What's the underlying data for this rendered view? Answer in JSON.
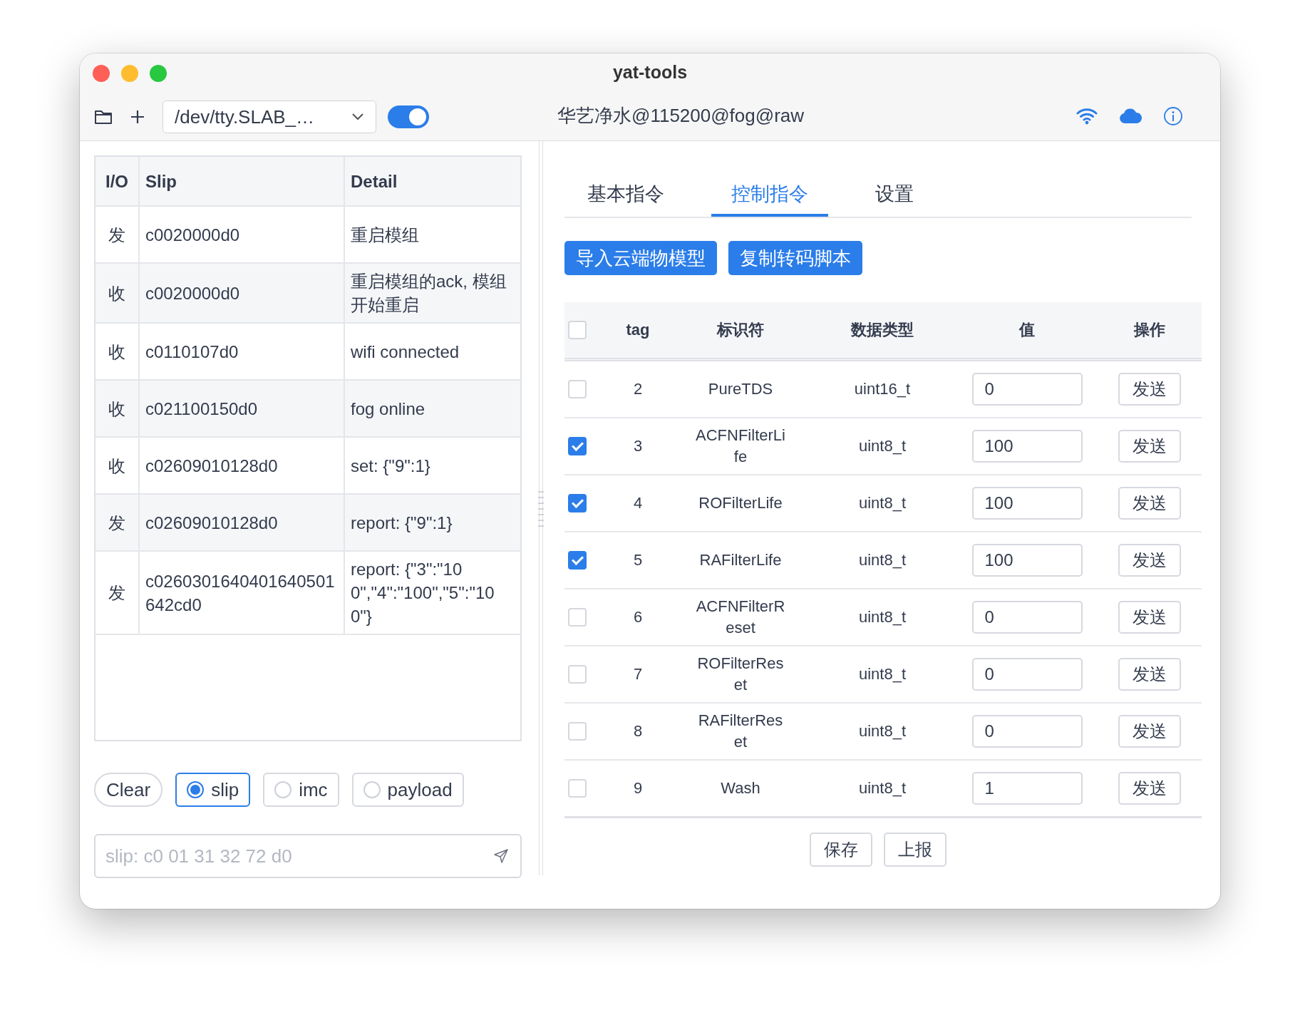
{
  "window": {
    "title": "yat-tools"
  },
  "toolbar": {
    "port": "/dev/tty.SLAB_…",
    "connected": true,
    "device": "华艺净水@115200@fog@raw"
  },
  "log": {
    "columns": [
      "I/O",
      "Slip",
      "Detail"
    ],
    "rows": [
      {
        "io": "发",
        "slip": "c0020000d0",
        "detail": "重启模组"
      },
      {
        "io": "收",
        "slip": "c0020000d0",
        "detail": "重启模组的ack, 模组开始重启"
      },
      {
        "io": "收",
        "slip": "c0110107d0",
        "detail": "wifi connected"
      },
      {
        "io": "收",
        "slip": "c021100150d0",
        "detail": "fog online"
      },
      {
        "io": "收",
        "slip": "c02609010128d0",
        "detail": "set: {\"9\":1}"
      },
      {
        "io": "发",
        "slip": "c02609010128d0",
        "detail": "report: {\"9\":1}"
      },
      {
        "io": "发",
        "slip": "c0260301640401640501642cd0",
        "detail": "report: {\"3\":\"100\",\"4\":\"100\",\"5\":\"100\"}"
      }
    ]
  },
  "log_controls": {
    "clear": "Clear",
    "formats": [
      {
        "label": "slip",
        "selected": true
      },
      {
        "label": "imc",
        "selected": false
      },
      {
        "label": "payload",
        "selected": false
      }
    ]
  },
  "input": {
    "placeholder": "slip: c0 01 31 32 72 d0"
  },
  "tabs": [
    {
      "label": "基本指令",
      "selected": false
    },
    {
      "label": "控制指令",
      "selected": true
    },
    {
      "label": "设置",
      "selected": false
    }
  ],
  "actions": [
    "导入云端物模型",
    "复制转码脚本"
  ],
  "props": {
    "columns": [
      "tag",
      "标识符",
      "数据类型",
      "值",
      "操作"
    ],
    "all_checked": false,
    "rows": [
      {
        "checked": false,
        "tag": "2",
        "name": "PureTDS",
        "type": "uint16_t",
        "value": "0",
        "action": "发送"
      },
      {
        "checked": true,
        "tag": "3",
        "name": "ACFNFilterLife",
        "type": "uint8_t",
        "value": "100",
        "action": "发送"
      },
      {
        "checked": true,
        "tag": "4",
        "name": "ROFilterLife",
        "type": "uint8_t",
        "value": "100",
        "action": "发送"
      },
      {
        "checked": true,
        "tag": "5",
        "name": "RAFilterLife",
        "type": "uint8_t",
        "value": "100",
        "action": "发送"
      },
      {
        "checked": false,
        "tag": "6",
        "name": "ACFNFilterReset",
        "type": "uint8_t",
        "value": "0",
        "action": "发送"
      },
      {
        "checked": false,
        "tag": "7",
        "name": "ROFilterReset",
        "type": "uint8_t",
        "value": "0",
        "action": "发送"
      },
      {
        "checked": false,
        "tag": "8",
        "name": "RAFilterReset",
        "type": "uint8_t",
        "value": "0",
        "action": "发送"
      },
      {
        "checked": false,
        "tag": "9",
        "name": "Wash",
        "type": "uint8_t",
        "value": "1",
        "action": "发送"
      }
    ]
  },
  "footer_buttons": [
    "保存",
    "上报"
  ]
}
